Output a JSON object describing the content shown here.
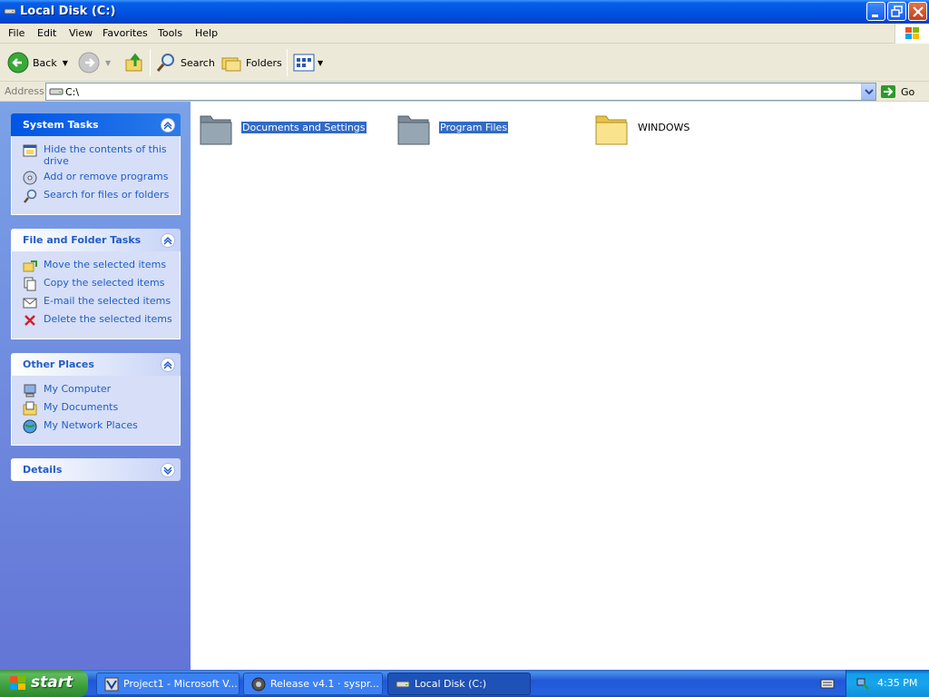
{
  "window": {
    "title": "Local Disk (C:)"
  },
  "menu": [
    "File",
    "Edit",
    "View",
    "Favorites",
    "Tools",
    "Help"
  ],
  "toolbar": {
    "back_label": "Back",
    "search_label": "Search",
    "folders_label": "Folders"
  },
  "address": {
    "label": "Address",
    "value": "C:\\",
    "go_label": "Go"
  },
  "taskpane": {
    "system_tasks": {
      "title": "System Tasks",
      "items": [
        "Hide the contents of this drive",
        "Add or remove programs",
        "Search for files or folders"
      ]
    },
    "file_folder_tasks": {
      "title": "File and Folder Tasks",
      "items": [
        "Move the selected items",
        "Copy the selected items",
        "E-mail the selected items",
        "Delete the selected items"
      ]
    },
    "other_places": {
      "title": "Other Places",
      "items": [
        "My Computer",
        "My Documents",
        "My Network Places"
      ]
    },
    "details": {
      "title": "Details"
    }
  },
  "files": [
    {
      "name": "Documents and Settings",
      "selected": true
    },
    {
      "name": "Program Files",
      "selected": true
    },
    {
      "name": "WINDOWS",
      "selected": false
    }
  ],
  "taskbar": {
    "start_label": "start",
    "tasks": [
      "Project1 - Microsoft V...",
      "Release v4.1 · syspr...",
      "Local Disk (C:)"
    ],
    "clock": "4:35 PM"
  },
  "colors": {
    "titlebar": "#0054e3",
    "taskpane": "#6f8fdf",
    "selection": "#316ac5",
    "link": "#215dc6"
  }
}
